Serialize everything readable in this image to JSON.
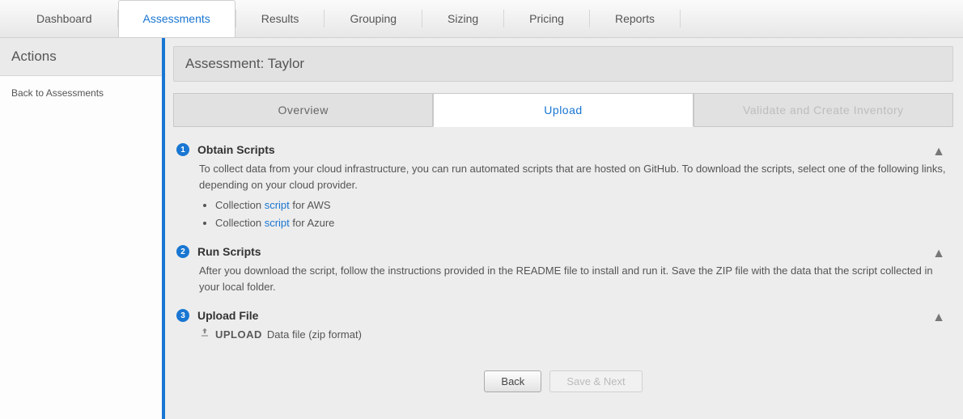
{
  "topnav": {
    "items": [
      {
        "label": "Dashboard"
      },
      {
        "label": "Assessments",
        "active": true
      },
      {
        "label": "Results"
      },
      {
        "label": "Grouping"
      },
      {
        "label": "Sizing"
      },
      {
        "label": "Pricing"
      },
      {
        "label": "Reports"
      }
    ]
  },
  "sidebar": {
    "title": "Actions",
    "back_link": "Back to Assessments"
  },
  "panel": {
    "title": "Assessment: Taylor"
  },
  "innertabs": {
    "overview": "Overview",
    "upload": "Upload",
    "validate": "Validate and Create Inventory"
  },
  "steps": {
    "s1": {
      "num": "1",
      "title": "Obtain Scripts",
      "desc": "To collect data from your cloud infrastructure, you can run automated scripts that are hosted on GitHub. To download the scripts, select one of the following links, depending on your cloud provider.",
      "li1_pre": "Collection ",
      "li1_link": "script",
      "li1_post": " for AWS",
      "li2_pre": "Collection ",
      "li2_link": "script",
      "li2_post": " for Azure"
    },
    "s2": {
      "num": "2",
      "title": "Run Scripts",
      "desc": "After you download the script, follow the instructions provided in the README file to install and run it. Save the ZIP file with the data that the script collected in your local folder."
    },
    "s3": {
      "num": "3",
      "title": "Upload File",
      "upload_label": "UPLOAD",
      "upload_desc": "Data file (zip format)"
    }
  },
  "footer": {
    "back": "Back",
    "save_next": "Save & Next"
  }
}
